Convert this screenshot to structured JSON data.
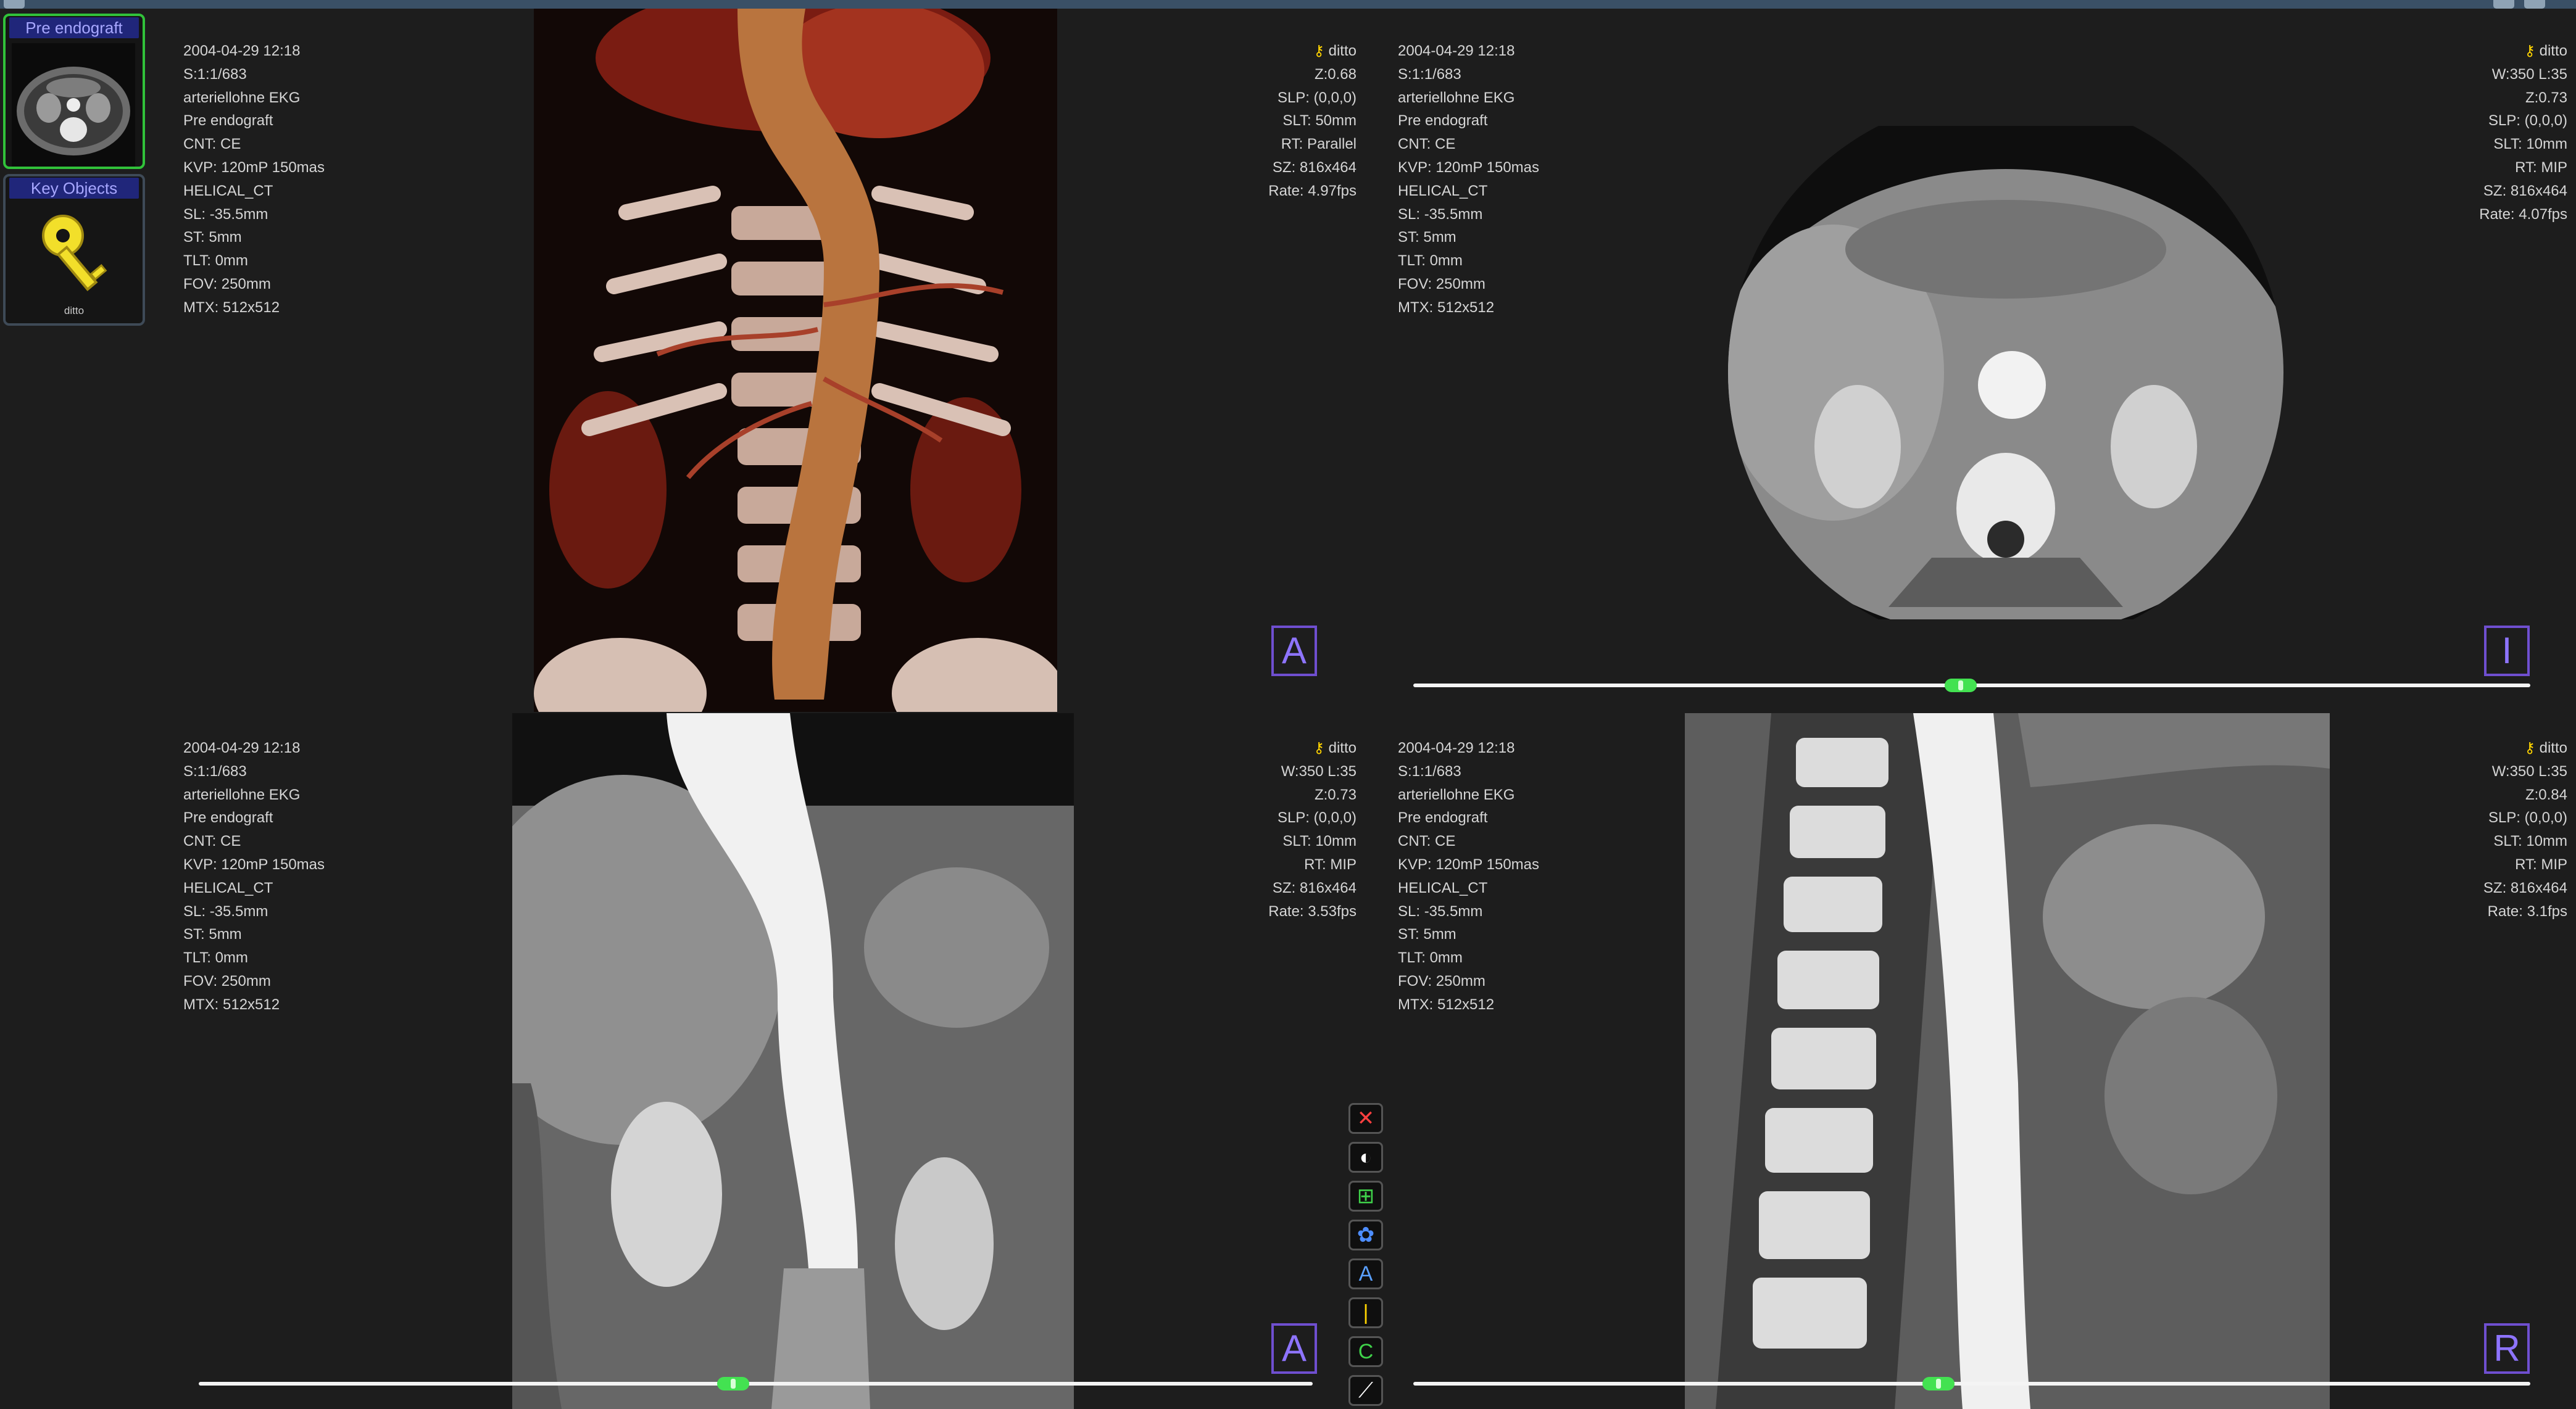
{
  "toolbar": {
    "color": "#3a5066"
  },
  "series_panel": {
    "thumbnail": {
      "label": "Pre endograft",
      "active": true
    },
    "key_objects": {
      "label": "Key Objects",
      "sublabel": "ditto"
    }
  },
  "viewports": [
    {
      "id": "vr",
      "left_lines": [
        "2004-04-29 12:18",
        "S:1:1/683",
        "arteriellohne EKG",
        "Pre endograft",
        "CNT: CE",
        "KVP: 120mP 150mas",
        "HELICAL_CT",
        "SL: -35.5mm",
        "ST: 5mm",
        "TLT: 0mm",
        "FOV: 250mm",
        "MTX: 512x512"
      ],
      "key_label": "ditto",
      "right_lines": [
        "Z:0.68",
        "SLP: (0,0,0)",
        "SLT: 50mm",
        "RT: Parallel",
        "SZ: 816x464",
        "Rate: 4.97fps"
      ],
      "orientation": "A"
    },
    {
      "id": "axial",
      "left_lines": [
        "2004-04-29 12:18",
        "S:1:1/683",
        "arteriellohne EKG",
        "Pre endograft",
        "CNT: CE",
        "KVP: 120mP 150mas",
        "HELICAL_CT",
        "SL: -35.5mm",
        "ST: 5mm",
        "TLT: 0mm",
        "FOV: 250mm",
        "MTX: 512x512"
      ],
      "key_label": "ditto",
      "right_lines": [
        "W:350 L:35",
        "Z:0.73",
        "SLP: (0,0,0)",
        "SLT: 10mm",
        "RT: MIP",
        "SZ: 816x464",
        "Rate: 4.07fps"
      ],
      "orientation": "I",
      "slider_position": 0.49
    },
    {
      "id": "coronal",
      "left_lines": [
        "2004-04-29 12:18",
        "S:1:1/683",
        "arteriellohne EKG",
        "Pre endograft",
        "CNT: CE",
        "KVP: 120mP 150mas",
        "HELICAL_CT",
        "SL: -35.5mm",
        "ST: 5mm",
        "TLT: 0mm",
        "FOV: 250mm",
        "MTX: 512x512"
      ],
      "key_label": "ditto",
      "right_lines": [
        "W:350 L:35",
        "Z:0.73",
        "SLP: (0,0,0)",
        "SLT: 10mm",
        "RT: MIP",
        "SZ: 816x464",
        "Rate: 3.53fps"
      ],
      "orientation": "A",
      "slider_position": 0.48
    },
    {
      "id": "sagittal",
      "left_lines": [
        "2004-04-29 12:18",
        "S:1:1/683",
        "arteriellohne EKG",
        "Pre endograft",
        "CNT: CE",
        "KVP: 120mP 150mas",
        "HELICAL_CT",
        "SL: -35.5mm",
        "ST: 5mm",
        "TLT: 0mm",
        "FOV: 250mm",
        "MTX: 512x512"
      ],
      "key_label": "ditto",
      "right_lines": [
        "W:350 L:35",
        "Z:0.84",
        "SLP: (0,0,0)",
        "SLT: 10mm",
        "RT: MIP",
        "SZ: 816x464",
        "Rate: 3.1fps"
      ],
      "orientation": "R",
      "slider_position": 0.47
    }
  ],
  "tools": [
    {
      "name": "close-tool",
      "glyph": "✕",
      "color": "#ff4040"
    },
    {
      "name": "contrast-tool",
      "glyph": "◐",
      "color": "#ffffff"
    },
    {
      "name": "layout-tool",
      "glyph": "⊞",
      "color": "#3fd24a"
    },
    {
      "name": "globe-tool",
      "glyph": "✿",
      "color": "#4d8dff"
    },
    {
      "name": "axial-plane-tool",
      "glyph": "A",
      "color": "#5aa0ff"
    },
    {
      "name": "line-tool",
      "glyph": "|",
      "color": "#ffd400"
    },
    {
      "name": "coronal-plane-tool",
      "glyph": "C",
      "color": "#3fd24a"
    },
    {
      "name": "probe-tool",
      "glyph": "⟋",
      "color": "#ffffff"
    }
  ]
}
